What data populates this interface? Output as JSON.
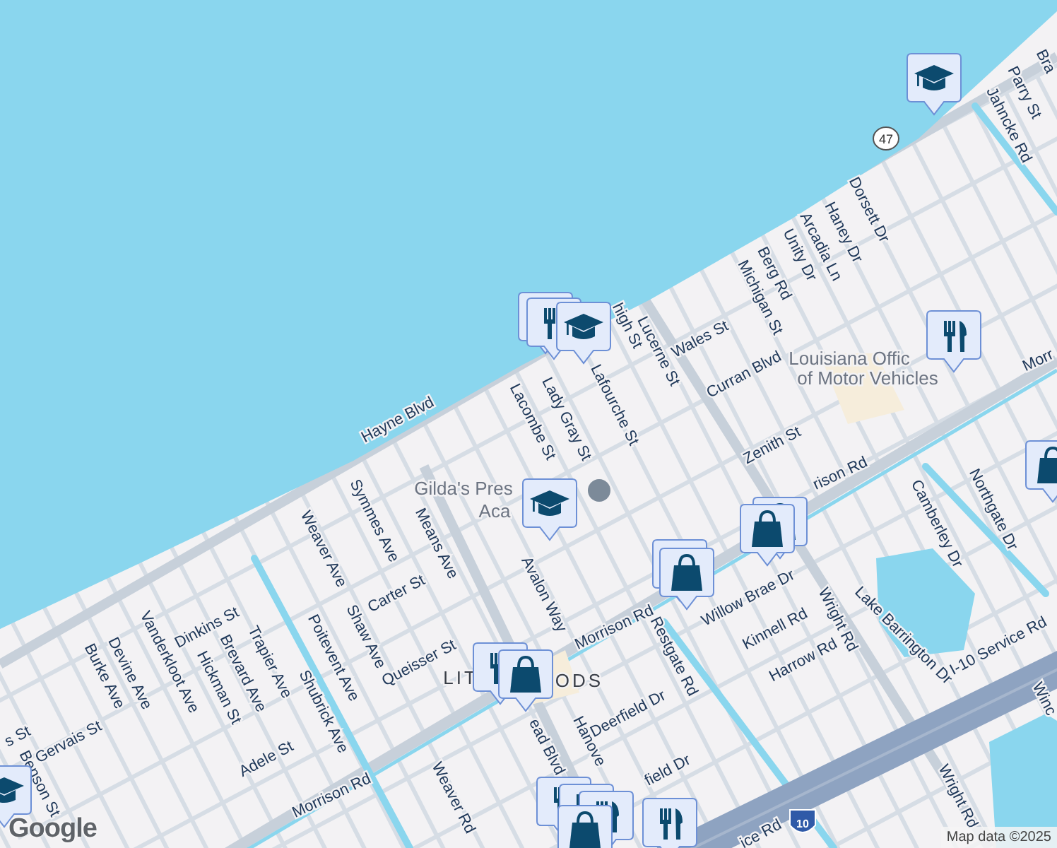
{
  "map_labels": [
    {
      "text": "Hayne Blvd",
      "kind": "street"
    },
    {
      "text": "Lucerne St",
      "kind": "street"
    },
    {
      "text": "Lafourche St",
      "kind": "street"
    },
    {
      "text": "high St",
      "kind": "street"
    },
    {
      "text": "Lady Gray St",
      "kind": "street"
    },
    {
      "text": "Lacombe St",
      "kind": "street"
    },
    {
      "text": "Wales St",
      "kind": "street"
    },
    {
      "text": "Curran Blvd",
      "kind": "street"
    },
    {
      "text": "Zenith St",
      "kind": "street"
    },
    {
      "text": "Michigan St",
      "kind": "street"
    },
    {
      "text": "Berg Rd",
      "kind": "street"
    },
    {
      "text": "Unity Dr",
      "kind": "street"
    },
    {
      "text": "Arcadia Ln",
      "kind": "street"
    },
    {
      "text": "Haney Dr",
      "kind": "street"
    },
    {
      "text": "Dorsett Dr",
      "kind": "street"
    },
    {
      "text": "Parry St",
      "kind": "street"
    },
    {
      "text": "Jahncke Rd",
      "kind": "street"
    },
    {
      "text": "Bra",
      "kind": "street"
    },
    {
      "text": "Louisiana Offic",
      "kind": "place"
    },
    {
      "text": "of Motor Vehicles",
      "kind": "place"
    },
    {
      "text": "Morr",
      "kind": "street"
    },
    {
      "text": "rison Rd",
      "kind": "street"
    },
    {
      "text": "Camberley Dr",
      "kind": "street"
    },
    {
      "text": "Northgate Dr",
      "kind": "street"
    },
    {
      "text": "Gilda's Pres",
      "kind": "place"
    },
    {
      "text": "Aca",
      "kind": "place"
    },
    {
      "text": "Symmes Ave",
      "kind": "street"
    },
    {
      "text": "Means Ave",
      "kind": "street"
    },
    {
      "text": "Weaver Ave",
      "kind": "street"
    },
    {
      "text": "Carter St",
      "kind": "street"
    },
    {
      "text": "Shaw Ave",
      "kind": "street"
    },
    {
      "text": "Poitevent Ave",
      "kind": "street"
    },
    {
      "text": "Queisser St",
      "kind": "street"
    },
    {
      "text": "Avalon Way",
      "kind": "street"
    },
    {
      "text": "Morrison Rd",
      "kind": "street"
    },
    {
      "text": "LIT",
      "kind": "area"
    },
    {
      "text": "ODS",
      "kind": "area"
    },
    {
      "text": "ead Blvd",
      "kind": "street"
    },
    {
      "text": "Restgate Rd",
      "kind": "street"
    },
    {
      "text": "Deerfield Dr",
      "kind": "street"
    },
    {
      "text": "Hanove",
      "kind": "street"
    },
    {
      "text": "field Dr",
      "kind": "street"
    },
    {
      "text": "Willow Brae Dr",
      "kind": "street"
    },
    {
      "text": "Kinnell Rd",
      "kind": "street"
    },
    {
      "text": "Harrow Rd",
      "kind": "street"
    },
    {
      "text": "Wright Rd",
      "kind": "street"
    },
    {
      "text": "Lake Barrington Dr",
      "kind": "street"
    },
    {
      "text": "I-10 Service Rd",
      "kind": "street"
    },
    {
      "text": "Wright Rd",
      "kind": "street"
    },
    {
      "text": "Winc",
      "kind": "street"
    },
    {
      "text": "Dinkins St",
      "kind": "street"
    },
    {
      "text": "Trapier Ave",
      "kind": "street"
    },
    {
      "text": "Brevard Ave",
      "kind": "street"
    },
    {
      "text": "Hickman St",
      "kind": "street"
    },
    {
      "text": "Vanderkloot Ave",
      "kind": "street"
    },
    {
      "text": "Devine Ave",
      "kind": "street"
    },
    {
      "text": "Burke Ave",
      "kind": "street"
    },
    {
      "text": "Shubrick Ave",
      "kind": "street"
    },
    {
      "text": "Adele St",
      "kind": "street"
    },
    {
      "text": "Gervais St",
      "kind": "street"
    },
    {
      "text": "Benson St",
      "kind": "street"
    },
    {
      "text": "s St",
      "kind": "street"
    },
    {
      "text": "Morrison Rd",
      "kind": "street"
    },
    {
      "text": "Weaver Rd",
      "kind": "street"
    },
    {
      "text": "ice Rd",
      "kind": "street"
    }
  ],
  "shields": [
    {
      "text": "47",
      "kind": "state"
    },
    {
      "text": "10",
      "kind": "interstate"
    }
  ],
  "pin_stacks": [
    {
      "pins": [
        {
          "kind": "school"
        }
      ]
    },
    {
      "pins": [
        {
          "kind": "restaurant"
        },
        {
          "kind": "restaurant"
        },
        {
          "kind": "school"
        }
      ]
    },
    {
      "pins": [
        {
          "kind": "restaurant"
        }
      ]
    },
    {
      "pins": [
        {
          "kind": "school"
        }
      ]
    },
    {
      "pins": [
        {
          "kind": "shopping"
        },
        {
          "kind": "shopping"
        }
      ]
    },
    {
      "pins": [
        {
          "kind": "restaurant"
        },
        {
          "kind": "shopping"
        }
      ]
    },
    {
      "pins": [
        {
          "kind": "restaurant"
        },
        {
          "kind": "shopping"
        }
      ]
    },
    {
      "pins": [
        {
          "kind": "school"
        }
      ]
    },
    {
      "pins": [
        {
          "kind": "restaurant"
        },
        {
          "kind": "restaurant"
        },
        {
          "kind": "restaurant"
        },
        {
          "kind": "shopping"
        }
      ]
    },
    {
      "pins": [
        {
          "kind": "restaurant"
        }
      ]
    },
    {
      "pins": [
        {
          "kind": "shopping"
        }
      ]
    }
  ],
  "logo": "Google",
  "attribution": "Map data ©2025"
}
